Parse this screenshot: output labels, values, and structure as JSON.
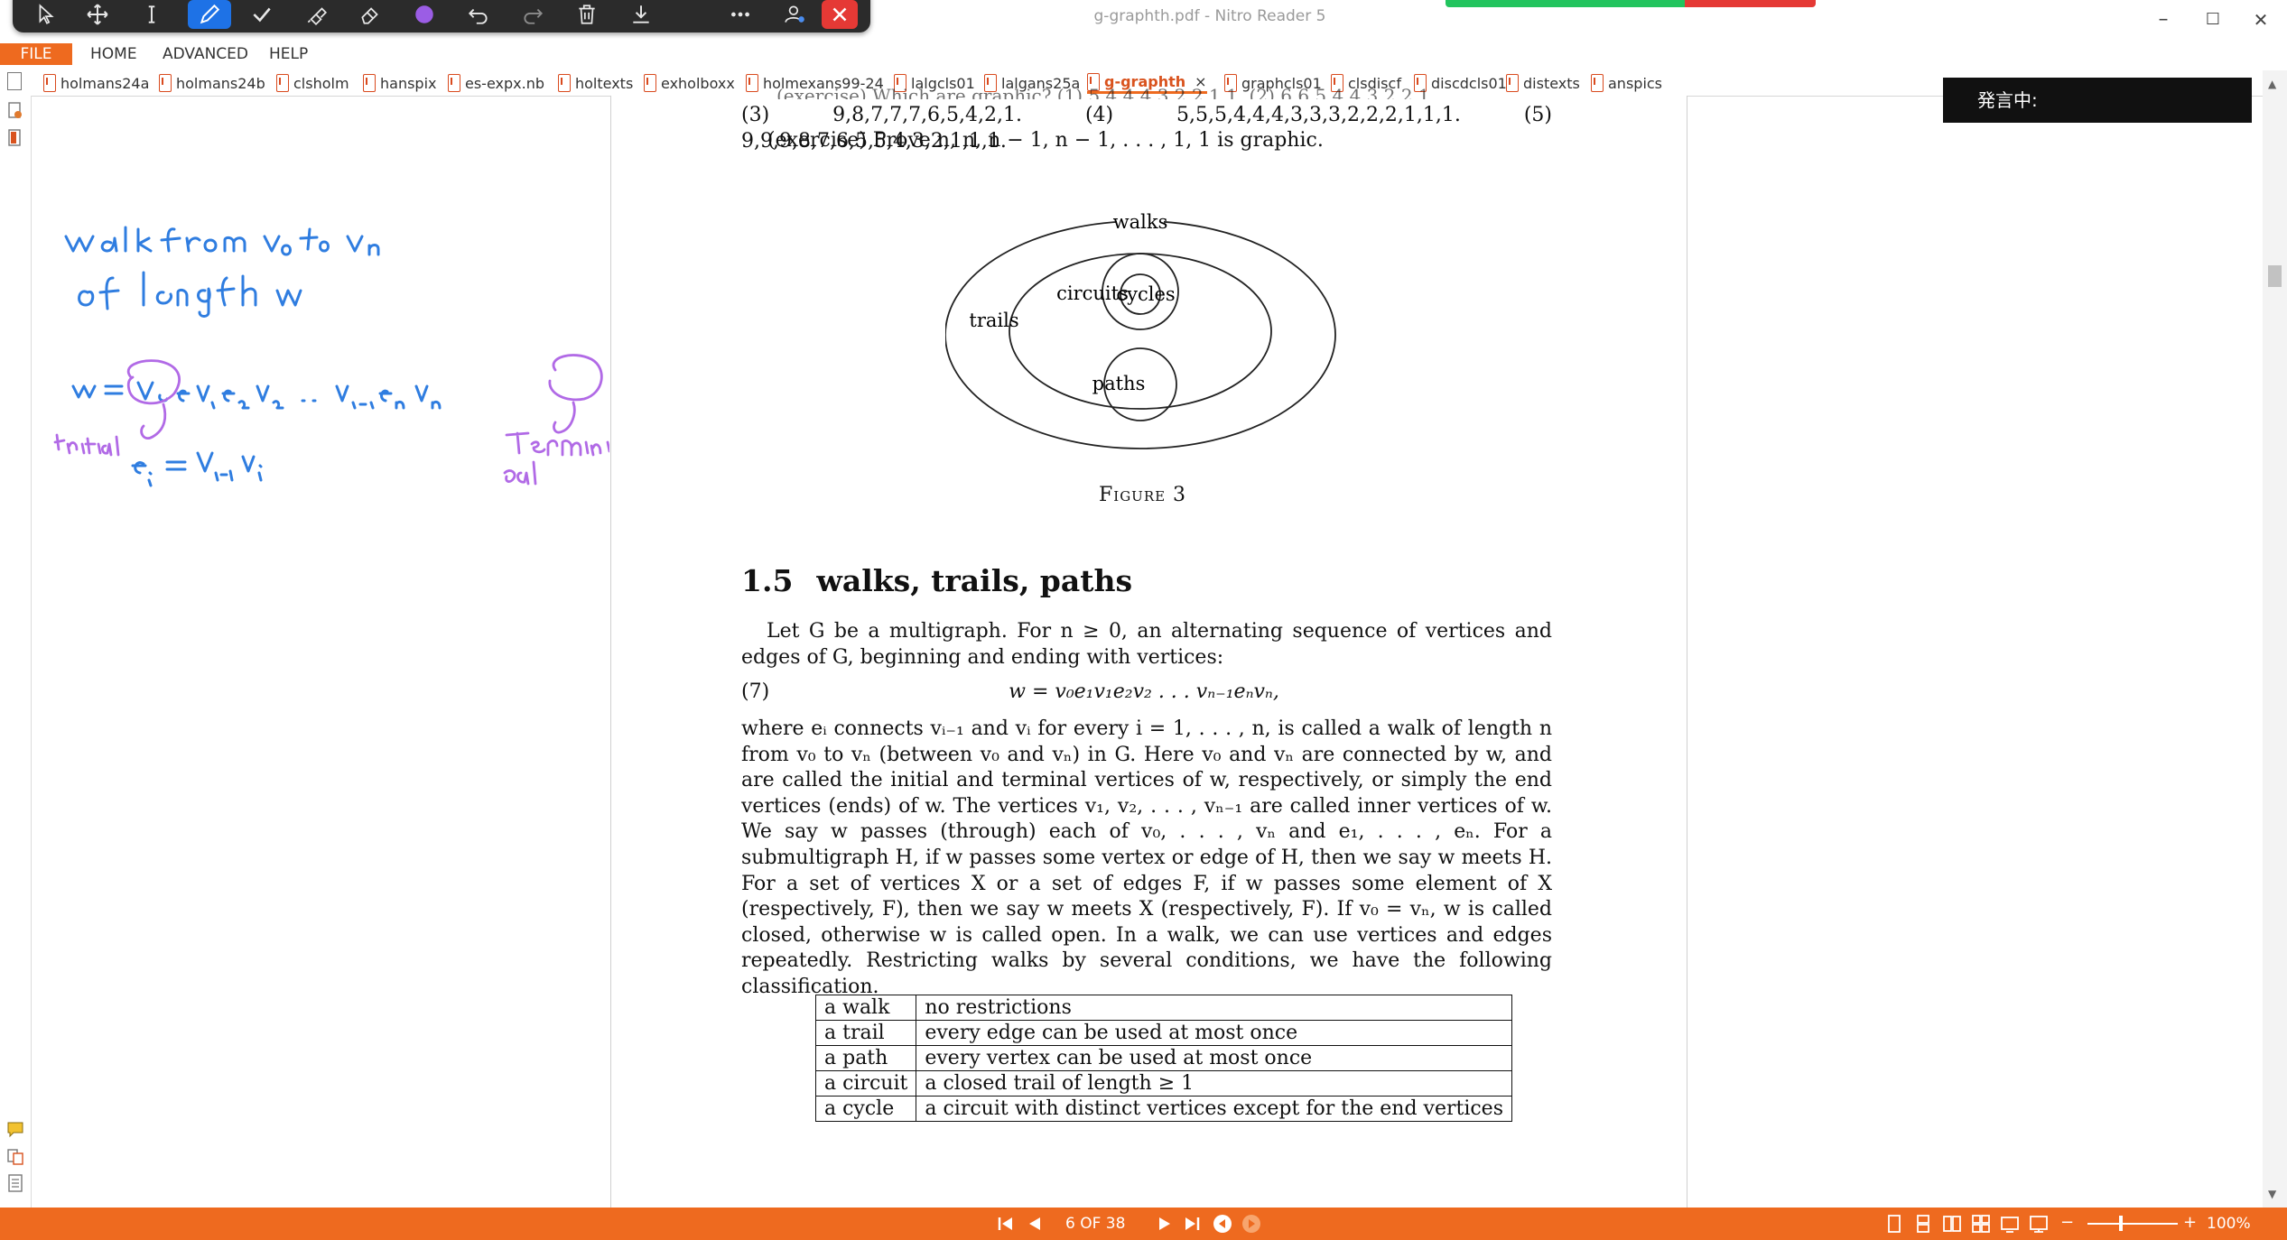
{
  "window": {
    "title": "g-graphth.pdf - Nitro Reader 5",
    "minimize": "–",
    "maximize": "☐",
    "close": "✕"
  },
  "menu": [
    "FILE",
    "HOME",
    "ADVANCED",
    "HELP"
  ],
  "tabs": [
    {
      "label": "holmans24a"
    },
    {
      "label": "holmans24b"
    },
    {
      "label": "clsholm"
    },
    {
      "label": "hanspix"
    },
    {
      "label": "es-expx.nb"
    },
    {
      "label": "holtexts"
    },
    {
      "label": "exholboxx"
    },
    {
      "label": "holmexans99-24"
    },
    {
      "label": "lalgcls01"
    },
    {
      "label": "lalgans25a"
    },
    {
      "label": "g-graphth",
      "active": true
    },
    {
      "label": "graphcls01"
    },
    {
      "label": "clsdiscf"
    },
    {
      "label": "discdcls01"
    },
    {
      "label": "distexts"
    },
    {
      "label": "anspics"
    }
  ],
  "tab_close": "×",
  "speaking_indicator": "発言中:",
  "page": {
    "line1": "(3) 9,8,7,7,7,6,5,4,2,1.  (4) 5,5,5,4,4,4,3,3,3,2,2,2,1,1,1.  (5) 9,9,9,8,7,6,5,5,4,3,2,1,1,1.",
    "line2": "(exercise) Prove n, n, n − 1, n − 1, . . . , 1, 1 is graphic.",
    "figure_labels": {
      "walks": "walks",
      "trails": "trails",
      "circuits": "circuits",
      "cycles": "cycles",
      "paths": "paths"
    },
    "figure_caption": "Figure 3",
    "section_number": "1.5",
    "section_title": "walks, trails, paths",
    "para1": "Let G be a multigraph. For n ≥ 0, an alternating sequence of vertices and edges of G, beginning and ending with vertices:",
    "eq_number": "(7)",
    "equation": "w = v₀e₁v₁e₂v₂ . . . vₙ₋₁eₙvₙ,",
    "para2": "where eᵢ connects vᵢ₋₁ and vᵢ for every i = 1, . . . , n, is called a walk of length n from v₀ to vₙ (between v₀ and vₙ) in G. Here v₀ and vₙ are connected by w, and are called the initial and terminal vertices of w, respectively, or simply the end vertices (ends) of w. The vertices v₁, v₂, . . . , vₙ₋₁ are called inner vertices of w. We say w passes (through) each of v₀, . . . , vₙ and e₁, . . . , eₙ. For a submultigraph H, if w passes some vertex or edge of H, then we say w meets H. For a set of vertices X or a set of edges F, if w passes some element of X (respectively, F), then we say w meets X (respectively, F). If v₀ = vₙ, w is called closed, otherwise w is called open. In a walk, we can use vertices and edges repeatedly. Restricting walks by several conditions, we have the following classification.",
    "table": [
      {
        "term": "a walk",
        "def": "no restrictions"
      },
      {
        "term": "a trail",
        "def": "every edge can be used at most once"
      },
      {
        "term": "a path",
        "def": "every vertex can be used at most once"
      },
      {
        "term": "a circuit",
        "def": "a closed trail of length ≥ 1"
      },
      {
        "term": "a cycle",
        "def": "a circuit with distinct vertices except for the end vertices"
      }
    ]
  },
  "statusbar": {
    "page_indicator": "6 OF 38",
    "zoom": "100%",
    "zoom_minus": "−",
    "zoom_plus": "+"
  },
  "colors": {
    "accent": "#ee6a1f",
    "ink_blue": "#2f7de0",
    "ink_purple": "#b16ae6",
    "pen_active": "#1e72e6",
    "close_red": "#e53935"
  }
}
